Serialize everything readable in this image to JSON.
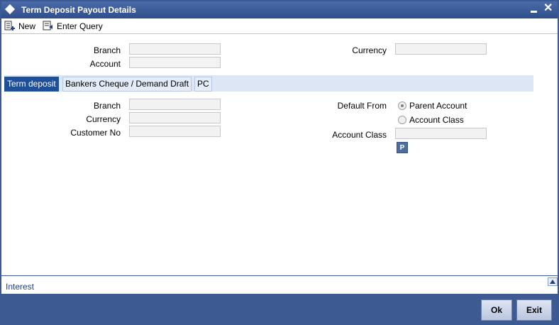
{
  "window": {
    "title": "Term Deposit Payout Details"
  },
  "toolbar": {
    "new_label": "New",
    "enter_query_label": "Enter Query"
  },
  "header": {
    "branch_label": "Branch",
    "account_label": "Account",
    "currency_label": "Currency",
    "branch_value": "",
    "account_value": "",
    "currency_value": ""
  },
  "tabs": [
    {
      "label": "Term deposit",
      "active": true
    },
    {
      "label": "Bankers Cheque / Demand Draft",
      "active": false
    },
    {
      "label": "PC",
      "active": false
    }
  ],
  "term_deposit": {
    "branch_label": "Branch",
    "currency_label": "Currency",
    "customer_no_label": "Customer No",
    "default_from_label": "Default From",
    "radio_parent_label": "Parent Account",
    "radio_class_label": "Account Class",
    "selected_default": "Parent Account",
    "account_class_label": "Account Class",
    "p_button_label": "P"
  },
  "bottom": {
    "interest_label": "Interest"
  },
  "footer": {
    "ok_label": "Ok",
    "exit_label": "Exit"
  },
  "colors": {
    "titlebar": "#2f4f8c",
    "footer": "#3e5a93",
    "active_tab": "#1f4f96"
  }
}
